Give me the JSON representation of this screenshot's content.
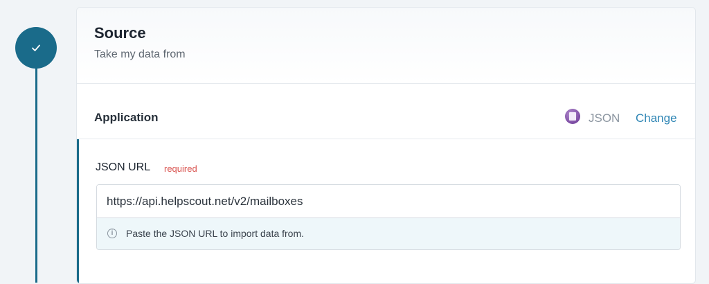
{
  "source": {
    "title": "Source",
    "subtitle": "Take my data from"
  },
  "application": {
    "label": "Application",
    "app_name": "JSON",
    "change_label": "Change",
    "icon": "json-app-icon"
  },
  "field": {
    "label": "JSON URL",
    "required_label": "required",
    "value": "https://api.helpscout.net/v2/mailboxes",
    "hint": "Paste the JSON URL to import data from.",
    "hint_icon": "info-icon"
  },
  "step": {
    "status_icon": "checkmark-icon"
  },
  "colors": {
    "accent": "#1a6b8a",
    "link": "#2f86b5",
    "required": "#d9534f",
    "hint_bg": "#eef7fa"
  }
}
